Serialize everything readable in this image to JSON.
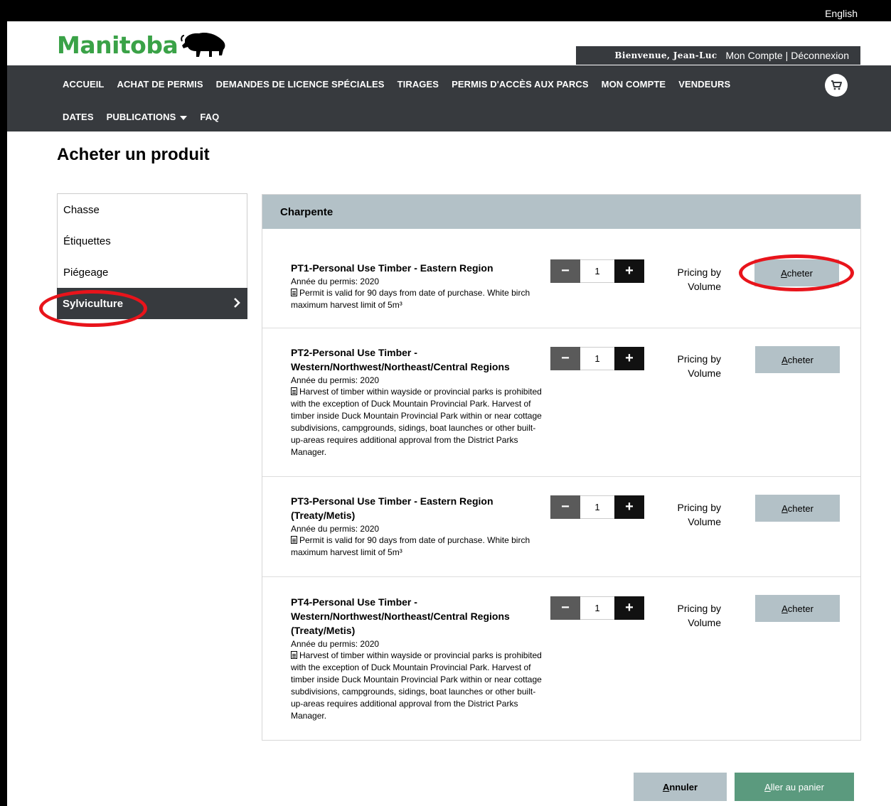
{
  "header": {
    "language_link": "English",
    "logo_text": "Manitoba",
    "welcome": "Bienvenue, Jean-Luc",
    "account_link": "Mon Compte",
    "separator": "|",
    "logout_link": "Déconnexion"
  },
  "nav": {
    "row1": [
      "ACCUEIL",
      "ACHAT DE PERMIS",
      "DEMANDES DE LICENCE SPÉCIALES",
      "TIRAGES",
      "PERMIS D'ACCÈS AUX PARCS",
      "MON COMPTE",
      "VENDEURS"
    ],
    "row2": [
      "DATES",
      "PUBLICATIONS",
      "FAQ"
    ]
  },
  "page": {
    "title": "Acheter un produit"
  },
  "sidebar": {
    "items": [
      "Chasse",
      "Étiquettes",
      "Piégeage",
      "Sylviculture"
    ],
    "active_index": 3
  },
  "panel": {
    "heading": "Charpente",
    "products": [
      {
        "name": "PT1-Personal Use Timber - Eastern Region",
        "year": "Année du permis: 2020",
        "description": "Permit is valid for 90 days from date of purchase. White birch maximum harvest limit of 5m³",
        "quantity": "1",
        "pricing_line1": "Pricing by",
        "pricing_line2": "Volume",
        "buy_first": "A",
        "buy_rest": "cheter"
      },
      {
        "name": "PT2-Personal Use Timber - Western/Northwest/Northeast/Central Regions",
        "year": "Année du permis: 2020",
        "description": "Harvest of timber within wayside or provincial parks is prohibited with the exception of Duck Mountain Provincial Park. Harvest of timber inside Duck Mountain Provincial Park within or near cottage subdivisions, campgrounds, sidings, boat launches or other built-up-areas requires additional approval from the District Parks Manager.",
        "quantity": "1",
        "pricing_line1": "Pricing by",
        "pricing_line2": "Volume",
        "buy_first": "A",
        "buy_rest": "cheter"
      },
      {
        "name": "PT3-Personal Use Timber - Eastern Region (Treaty/Metis)",
        "year": "Année du permis: 2020",
        "description": "Permit is valid for 90 days from date of purchase. White birch maximum harvest limit of 5m³",
        "quantity": "1",
        "pricing_line1": "Pricing by",
        "pricing_line2": "Volume",
        "buy_first": "A",
        "buy_rest": "cheter"
      },
      {
        "name": "PT4-Personal Use Timber - Western/Northwest/Northeast/Central Regions (Treaty/Metis)",
        "year": "Année du permis: 2020",
        "description": "Harvest of timber within wayside or provincial parks is prohibited with the exception of Duck Mountain Provincial Park. Harvest of timber inside Duck Mountain Provincial Park within or near cottage subdivisions, campgrounds, sidings, boat launches or other built-up-areas requires additional approval from the District Parks Manager.",
        "quantity": "1",
        "pricing_line1": "Pricing by",
        "pricing_line2": "Volume",
        "buy_first": "A",
        "buy_rest": "cheter"
      }
    ]
  },
  "footer": {
    "cancel_first": "A",
    "cancel_rest": "nnuler",
    "cart_first": "A",
    "cart_rest": "ller au panier"
  },
  "colors": {
    "brand_green": "#3aa247",
    "nav_bg": "#373a3e",
    "panel_header": "#b3c1c7",
    "cart_button": "#5b9a7e",
    "highlight_ring": "#e8141b"
  }
}
